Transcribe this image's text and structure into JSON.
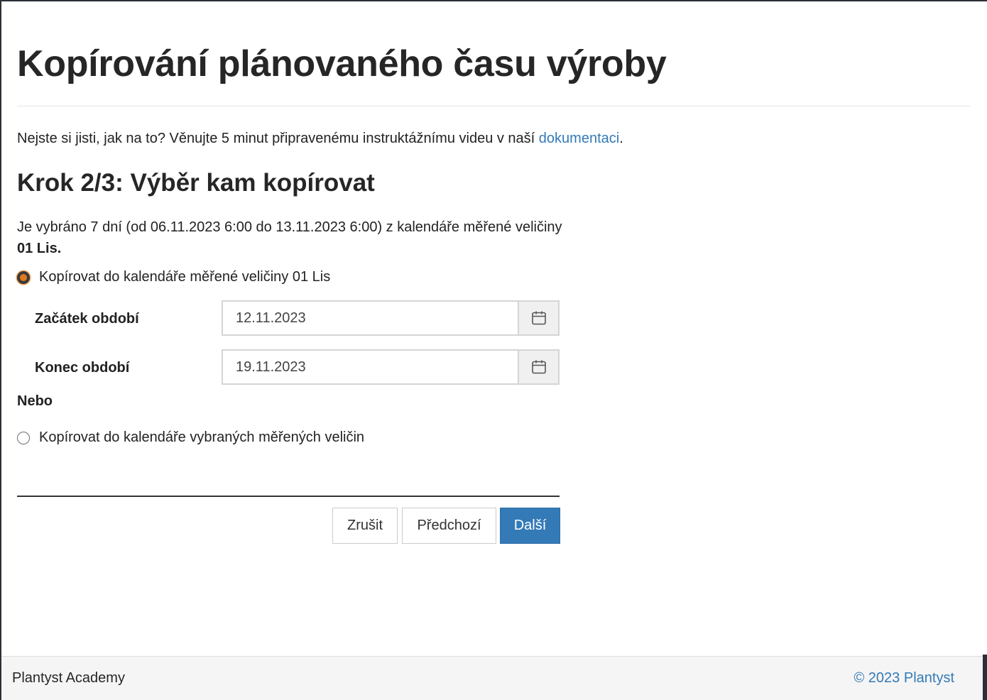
{
  "page": {
    "title": "Kopírování plánovaného času výroby"
  },
  "help": {
    "text": "Nejste si jisti, jak na to? Věnujte 5 minut připravenému instruktážnímu videu v naší ",
    "link_label": "dokumentaci",
    "suffix": "."
  },
  "step": {
    "heading": "Krok 2/3: Výběr kam kopírovat",
    "selection_text": "Je vybráno 7 dní (od 06.11.2023 6:00 do 13.11.2023 6:00) z kalendáře měřené veličiny ",
    "selection_bold": "01 Lis."
  },
  "options": {
    "single": {
      "label": "Kopírovat do kalendáře měřené veličiny 01 Lis",
      "checked": true
    },
    "or_label": "Nebo",
    "multiple": {
      "label": "Kopírovat do kalendáře vybraných měřených veličin",
      "checked": false
    }
  },
  "period": {
    "start_label": "Začátek období",
    "start_value": "12.11.2023",
    "end_label": "Konec období",
    "end_value": "19.11.2023",
    "calendar_icon": "calendar-icon"
  },
  "buttons": {
    "cancel": "Zrušit",
    "previous": "Předchozí",
    "next": "Další"
  },
  "footer": {
    "left": "Plantyst Academy",
    "right": "© 2023 Plantyst"
  },
  "colors": {
    "link": "#337ab7",
    "primary": "#337ab7",
    "radio_accent": "#e07a1f"
  }
}
